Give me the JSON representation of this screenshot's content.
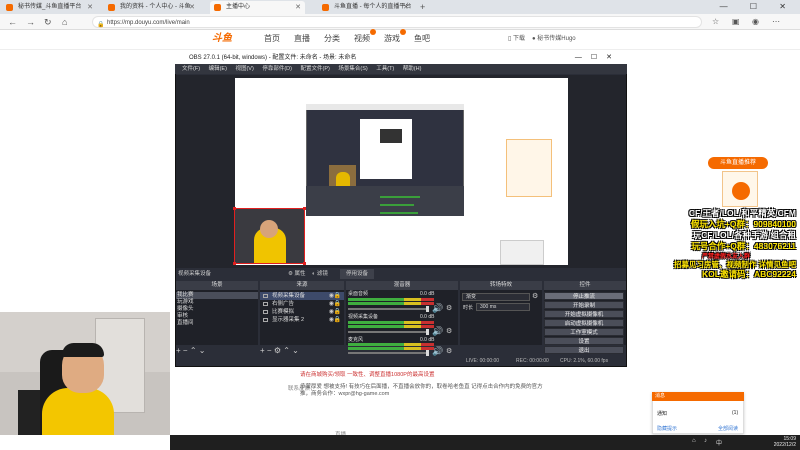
{
  "browser": {
    "tabs": [
      {
        "label": "秘书传媒_斗鱼直播平台",
        "active": false
      },
      {
        "label": "我的资料 - 个人中心 - 斗鱼",
        "active": false
      },
      {
        "label": "主播中心",
        "active": true
      },
      {
        "label": "斗鱼直播 - 每个人的直播平台",
        "active": false
      }
    ],
    "url": "https://mp.douyu.com/live/main",
    "window_controls": "— ☐ ✕",
    "new_tab": "+"
  },
  "site": {
    "logo": "斗鱼",
    "nav": [
      "首页",
      "直播",
      "分类",
      "视频",
      "游戏",
      "鱼吧"
    ],
    "active_nav": "直播",
    "download": "下载",
    "user": "秘书传媒Hugo"
  },
  "obs": {
    "title": "OBS 27.0.1 (64-bit, windows) - 配置文件: 未命名 - 场景: 未命名",
    "menu": [
      "文件(F)",
      "编辑(E)",
      "视图(V)",
      "停靠部件(D)",
      "配置文件(P)",
      "场景集合(S)",
      "工具(T)",
      "帮助(H)"
    ],
    "source_bar": {
      "selected": "视频采集设备",
      "props": "属性",
      "filters": "滤镜",
      "device": "停用设备"
    },
    "docks": {
      "scenes": {
        "title": "场景",
        "items": [
          "我比赛",
          "玩游戏",
          "摄像头",
          "审核",
          "直播间"
        ],
        "selected": 0
      },
      "sources": {
        "title": "来源",
        "items": [
          "视频采集设备",
          "右侧广告",
          "比赛模拟",
          "显示器采集 2"
        ],
        "selected": 0
      },
      "mixer": {
        "title": "混音器",
        "channels": [
          {
            "name": "桌面音频",
            "level": "0.0 dB"
          },
          {
            "name": "视频采集设备",
            "level": "0.0 dB"
          },
          {
            "name": "麦克风",
            "level": "0.0 dB"
          }
        ]
      },
      "transitions": {
        "title": "转场特效",
        "type": "渐变",
        "duration_label": "时长",
        "duration": "300 ms"
      },
      "controls": {
        "title": "控件",
        "buttons": [
          "停止推流",
          "开始录制",
          "开始虚拟摄像机",
          "启动虚拟摄像机",
          "工作室模式",
          "设置",
          "退出"
        ]
      }
    },
    "status": {
      "live": "LIVE: 00:00:00",
      "rec": "REC: 00:00:00",
      "cpu": "CPU: 2.1%, 60.00 fps"
    }
  },
  "promo": {
    "badge": "斗鱼直播推荐",
    "lines": [
      {
        "text": "CF/王者/LOL/和平精英/CFM",
        "color": "white"
      },
      {
        "text": "假玩入坑+Q群：909840100",
        "color": "mixed"
      },
      {
        "text": "玩CF/LOL/各种手游/组合租",
        "color": "white"
      },
      {
        "text": "玩号合作+Q群：483076211",
        "color": "mixed"
      },
      {
        "text": "严禁虚假水友入群",
        "color": "red"
      },
      {
        "text": "招募见习房管、视频制作 详情见鱼吧",
        "color": "white"
      },
      {
        "text": "KOL邀请码：ABC92224",
        "color": "mixed"
      }
    ]
  },
  "page": {
    "note_label": "联系反馈：",
    "note": "承蒙厚爱 想被支持! 有技巧在后面播，不直播会放你的，取卷哈老鱼直 记得点击合作内的免费的官方推，商务合作：wxpr@hg-game.com",
    "alert": "请在商城购买/领取 一致性、调整直播1080P的最高设置",
    "footer": "直播",
    "notify": {
      "title": "消息",
      "item": "通知",
      "count": "(1)",
      "link1": "隐藏提示",
      "link2": "全部阅读"
    }
  },
  "taskbar": {
    "time": "15:09",
    "date": "2022/12/2",
    "lang": "中"
  }
}
